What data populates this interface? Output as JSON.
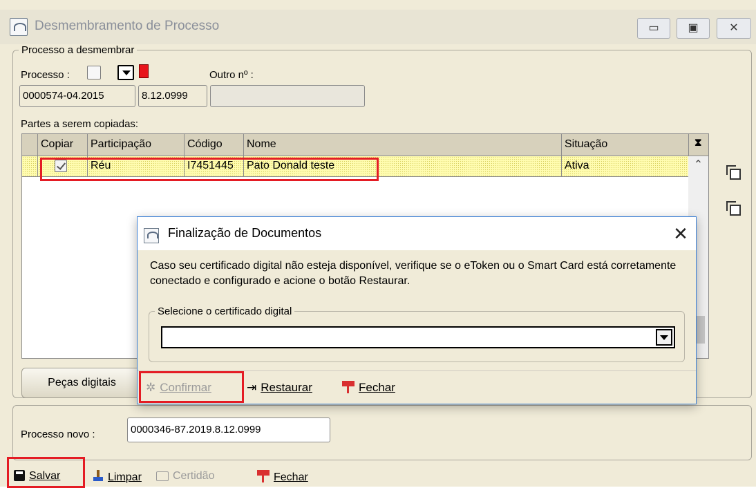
{
  "window": {
    "title": "Desmembramento de Processo",
    "min_glyph": "▭",
    "max_glyph": "▣",
    "close_glyph": "✕"
  },
  "group_process": {
    "legend": "Processo a desmembrar",
    "processo_label": "Processo :",
    "outro_label": "Outro nº :",
    "numero": "0000574-04.2015",
    "foro": "8.12.0999",
    "outro_value": ""
  },
  "parties": {
    "label": "Partes a serem copiadas:",
    "columns": [
      "Copiar",
      "Participação",
      "Código",
      "Nome",
      "Situação"
    ],
    "rows": [
      {
        "copiar": true,
        "participacao": "Réu",
        "codigo": "I7451445",
        "nome": "Pato Donald teste",
        "situacao": "Ativa"
      }
    ]
  },
  "tabs": {
    "pecas": "Peças digitais"
  },
  "novo": {
    "label": "Processo novo :",
    "value": "0000346-87.2019.8.12.0999"
  },
  "footer": {
    "salvar": "Salvar",
    "limpar": "Limpar",
    "certidao": "Certidão",
    "fechar": "Fechar"
  },
  "dialog": {
    "title": "Finalização de Documentos",
    "message": "Caso seu certificado digital não esteja disponível, verifique se o eToken ou o Smart Card está corretamente conectado e configurado e acione o botão Restaurar.",
    "group_legend": "Selecione o certificado digital",
    "selected_certificate": "",
    "confirmar": "Confirmar",
    "restaurar": "Restaurar",
    "fechar": "Fechar"
  },
  "colors": {
    "window_bg": "#f0ebd8",
    "highlight": "#e41c24",
    "row_bg": "#fffcb0",
    "dialog_border": "#3a7fd5"
  }
}
